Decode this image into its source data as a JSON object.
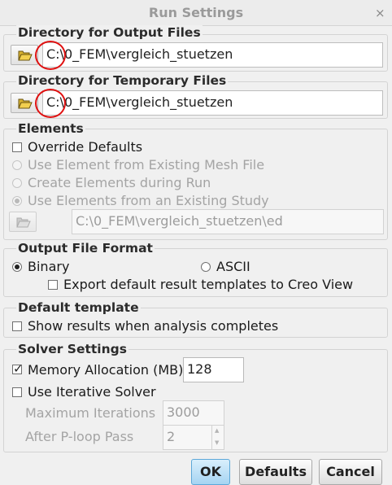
{
  "window": {
    "title": "Run Settings",
    "close_glyph": "×"
  },
  "output_dir": {
    "heading": "Directory for Output Files",
    "path": "C:\\0_FEM\\vergleich_stuetzen"
  },
  "temp_dir": {
    "heading": "Directory for Temporary Files",
    "path": "C:\\0_FEM\\vergleich_stuetzen"
  },
  "elements": {
    "heading": "Elements",
    "override_label": "Override Defaults",
    "override_checked": false,
    "opt_existing_mesh": "Use Element from Existing Mesh File",
    "opt_create_during_run": "Create Elements during Run",
    "opt_existing_study": "Use Elements from an Existing Study",
    "study_path": "C:\\0_FEM\\vergleich_stuetzen\\ed"
  },
  "output_format": {
    "heading": "Output File Format",
    "binary_label": "Binary",
    "ascii_label": "ASCII",
    "selected": "Binary",
    "export_label": "Export default result templates to Creo View"
  },
  "default_template": {
    "heading": "Default template",
    "show_results_label": "Show results when analysis completes"
  },
  "solver": {
    "heading": "Solver Settings",
    "memory_label": "Memory Allocation (MB)",
    "memory_value": "128",
    "memory_checked": true,
    "iterative_label": "Use Iterative Solver",
    "max_iter_label": "Maximum  Iterations",
    "max_iter_value": "3000",
    "after_ploop_label": "After P-loop Pass",
    "after_ploop_value": "2"
  },
  "buttons": {
    "ok": "OK",
    "defaults": "Defaults",
    "cancel": "Cancel"
  },
  "icons": {
    "folder": "folder-open-icon"
  },
  "colors": {
    "accent": "#a6d4f2",
    "annotation": "#e01010",
    "folder": "#d8b230"
  }
}
